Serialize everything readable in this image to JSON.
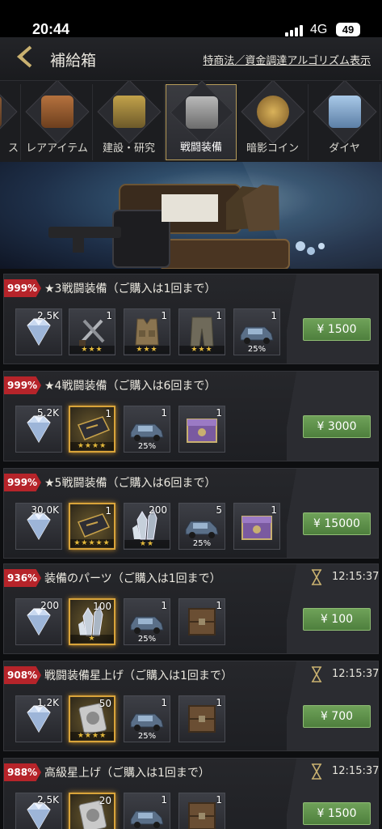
{
  "status": {
    "time": "20:44",
    "network": "4G",
    "battery": "49"
  },
  "header": {
    "title": "補給箱",
    "law_link": "特商法／資金調達アルゴリズム表示"
  },
  "tabs": [
    {
      "label": "ス"
    },
    {
      "label": "レアアイテム"
    },
    {
      "label": "建設・研究"
    },
    {
      "label": "戦闘装備",
      "active": true
    },
    {
      "label": "暗影コイン"
    },
    {
      "label": "ダイヤ"
    }
  ],
  "packs": [
    {
      "badge": "999%",
      "title": "★3戦闘装備（ご購入は1回まで）",
      "timer": "",
      "price": "¥ 1500",
      "items": [
        {
          "icon": "diamond",
          "count": "2.5K",
          "stars": "",
          "pct": ""
        },
        {
          "icon": "daggers",
          "count": "1",
          "stars": "★★★",
          "pct": ""
        },
        {
          "icon": "vest",
          "count": "1",
          "stars": "★★★",
          "pct": ""
        },
        {
          "icon": "pants",
          "count": "1",
          "stars": "★★★",
          "pct": ""
        },
        {
          "icon": "car",
          "count": "1",
          "stars": "",
          "pct": "25%"
        }
      ]
    },
    {
      "badge": "999%",
      "title": "★4戦闘装備（ご購入は6回まで）",
      "timer": "",
      "price": "¥ 3000",
      "items": [
        {
          "icon": "diamond",
          "count": "5.2K",
          "stars": "",
          "pct": ""
        },
        {
          "icon": "book",
          "count": "1",
          "stars": "★★★★",
          "pct": "",
          "gold": true
        },
        {
          "icon": "car",
          "count": "1",
          "stars": "",
          "pct": "25%"
        },
        {
          "icon": "chest-purple",
          "count": "1",
          "stars": "",
          "pct": ""
        }
      ]
    },
    {
      "badge": "999%",
      "title": "★5戦闘装備（ご購入は6回まで）",
      "timer": "",
      "price": "¥ 15000",
      "items": [
        {
          "icon": "diamond",
          "count": "30.0K",
          "stars": "",
          "pct": ""
        },
        {
          "icon": "book",
          "count": "1",
          "stars": "★★★★★",
          "pct": "",
          "gold": true
        },
        {
          "icon": "crystal",
          "count": "200",
          "stars": "★★",
          "pct": ""
        },
        {
          "icon": "car",
          "count": "5",
          "stars": "",
          "pct": "25%"
        },
        {
          "icon": "chest-purple",
          "count": "1",
          "stars": "",
          "pct": ""
        }
      ]
    },
    {
      "badge": "936%",
      "title": "装備のパーツ（ご購入は1回まで）",
      "timer": "12:15:37",
      "price": "¥ 100",
      "items": [
        {
          "icon": "diamond",
          "count": "200",
          "stars": "",
          "pct": ""
        },
        {
          "icon": "crystal",
          "count": "100",
          "stars": "★",
          "pct": "",
          "gold": true
        },
        {
          "icon": "car",
          "count": "1",
          "stars": "",
          "pct": "25%"
        },
        {
          "icon": "crate",
          "count": "1",
          "stars": "",
          "pct": ""
        }
      ]
    },
    {
      "badge": "908%",
      "title": "戦闘装備星上げ（ご購入は1回まで）",
      "timer": "12:15:37",
      "price": "¥ 700",
      "items": [
        {
          "icon": "diamond",
          "count": "1.2K",
          "stars": "",
          "pct": ""
        },
        {
          "icon": "book-silver",
          "count": "50",
          "stars": "★★★★",
          "pct": "",
          "gold": true
        },
        {
          "icon": "car",
          "count": "1",
          "stars": "",
          "pct": "25%"
        },
        {
          "icon": "crate",
          "count": "1",
          "stars": "",
          "pct": ""
        }
      ]
    },
    {
      "badge": "988%",
      "title": "高級星上げ（ご購入は1回まで）",
      "timer": "12:15:37",
      "price": "¥ 1500",
      "items": [
        {
          "icon": "diamond",
          "count": "2.5K",
          "stars": "",
          "pct": ""
        },
        {
          "icon": "book-silver",
          "count": "20",
          "stars": "",
          "pct": "",
          "gold": true
        },
        {
          "icon": "car",
          "count": "1",
          "stars": "",
          "pct": ""
        },
        {
          "icon": "crate",
          "count": "1",
          "stars": "",
          "pct": ""
        }
      ]
    }
  ]
}
